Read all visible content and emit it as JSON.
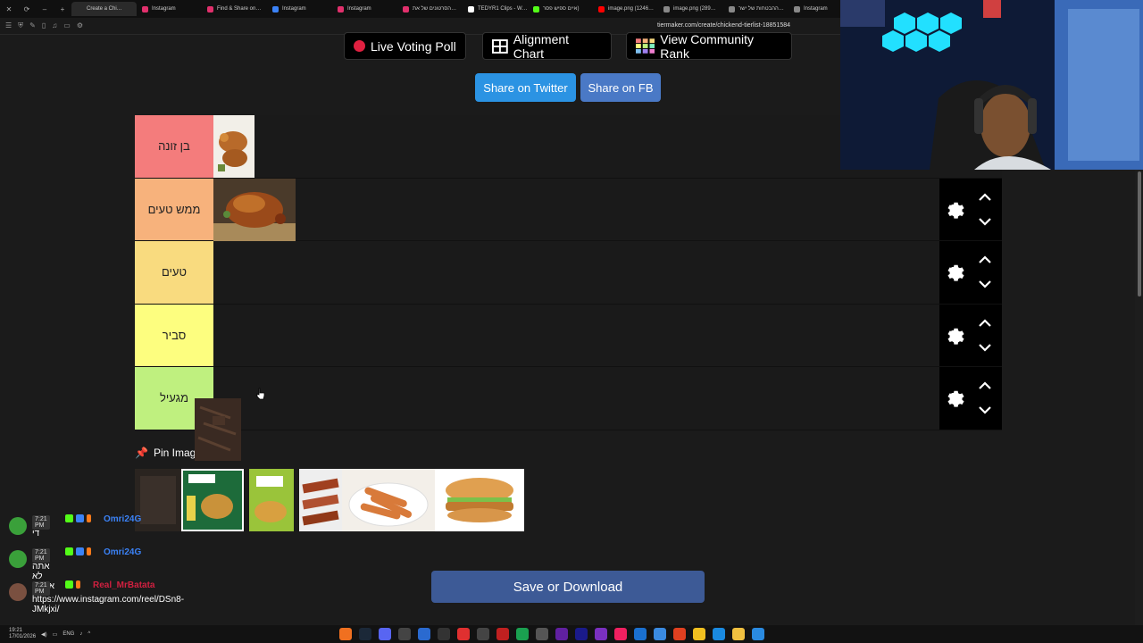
{
  "browser": {
    "tabs": [
      {
        "label": "Create a Chi…",
        "color": "#2a2a2a",
        "active": true
      },
      {
        "label": "Instagram",
        "color": "#e1306c"
      },
      {
        "label": "Find & Share on…",
        "color": "#e1306c"
      },
      {
        "label": "Instagram",
        "color": "#3b82f6"
      },
      {
        "label": "Instagram",
        "color": "#e1306c"
      },
      {
        "label": "הסרטונים של את…",
        "color": "#e1306c"
      },
      {
        "label": "TEDYR1 Clips - W…",
        "color": "#ffffff"
      },
      {
        "label": "איים ספיש פסר)",
        "color": "#53fc18"
      },
      {
        "label": "image.png (1246…",
        "color": "#ff0000"
      },
      {
        "label": "image.png (289…",
        "color": "#888888"
      },
      {
        "label": "ההבטחות של ישר…",
        "color": "#888888"
      },
      {
        "label": "Instagram",
        "color": "#888888"
      }
    ],
    "url": "tiermaker.com/create/chickend-tierlist-18851584"
  },
  "top_buttons": [
    {
      "label": "Live Voting Poll",
      "icon": "red-dot-icon"
    },
    {
      "label": "Alignment Chart",
      "icon": "grid-icon"
    },
    {
      "label": "View Community Rank",
      "icon": "color-grid-icon"
    }
  ],
  "share": {
    "twitter": "Share on Twitter",
    "fb": "Share on FB"
  },
  "tiers": [
    {
      "label": "בן זונה",
      "color": "#f47c7c"
    },
    {
      "label": "ממש טעים",
      "color": "#f7b27c"
    },
    {
      "label": "טעים",
      "color": "#f9db7f"
    },
    {
      "label": "סביר",
      "color": "#fdfe7f"
    },
    {
      "label": "מגעיל",
      "color": "#bff07f"
    }
  ],
  "pin_label": "Pin Imag",
  "save_label": "Save or Download",
  "chat": [
    {
      "time": "7:21 PM",
      "user": "Omri24G",
      "user_color": "#3b82f6",
      "text": "די",
      "avatar": "#3aa03a"
    },
    {
      "time": "7:21 PM",
      "user": "Omri24G",
      "user_color": "#3b82f6",
      "text": "אתה לא אמיתי",
      "avatar": "#3aa03a"
    },
    {
      "time": "7:21 PM",
      "user": "Real_MrBatata",
      "user_color": "#d02040",
      "text": "https://www.instagram.com/reel/DSn8-JMkjxi/",
      "avatar": "#7a5040"
    }
  ],
  "taskbar": {
    "time": "19:21",
    "date": "17/01/2026",
    "lang": "ENG"
  }
}
